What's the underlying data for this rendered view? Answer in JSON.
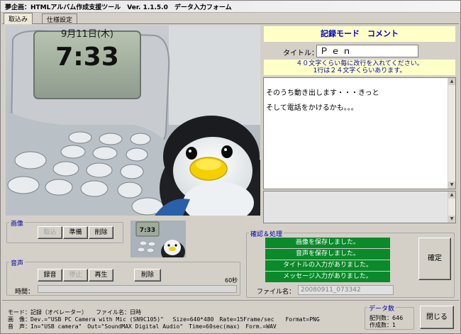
{
  "window": {
    "title": "夢企画：HTMLアルバム作成支援ツール　Ver. 1.1.5.0　データ入力フォーム"
  },
  "tabs": [
    {
      "label": "取込み",
      "active": true
    },
    {
      "label": "仕様設定",
      "active": false
    }
  ],
  "image_group": {
    "label": "画像",
    "buttons": [
      {
        "label": "取込",
        "enabled": false
      },
      {
        "label": "準備",
        "enabled": true
      },
      {
        "label": "削除",
        "enabled": true
      }
    ]
  },
  "audio_group": {
    "label": "音声",
    "buttons": [
      {
        "label": "録音",
        "enabled": true
      },
      {
        "label": "停止",
        "enabled": false
      },
      {
        "label": "再生",
        "enabled": true
      },
      {
        "label": "削除",
        "enabled": true
      }
    ],
    "max_time": "60秒",
    "time_label": "時間："
  },
  "record_mode": {
    "heading": "記録モード　コメント",
    "title_label": "タイトル：",
    "title_value": "Ｐｅｎ",
    "hint_line1": "４０文字くらい毎に改行を入れてください。",
    "hint_line2": "1行は２４文字くらいあります。",
    "memo_lines": [
      "そのうち動き出します・・・きっと",
      "そして電話をかけるかも。。。"
    ]
  },
  "confirm_group": {
    "label": "確認＆処理",
    "statuses": [
      "画像を保存しました。",
      "音声を保存しました。",
      "タイトルの入力がありました。",
      "メッセージ入力がありました。"
    ],
    "confirm_button": "確定",
    "filename_label": "ファイル名：",
    "filename_value": "20080911_073342"
  },
  "info": {
    "mode_line": "モード：記録（オペレーター）　　ファイル名：日時",
    "image_line": "画　像：Dev.=\"USB PC Camera with Mic (SN9C105)\"　 Size=640*480　Rate=15Frame/sec　　Format=PNG",
    "audio_line": "音　声：In=\"USB camera\"　Out=\"SoundMAX Digital Audio\"　Time=60sec(max)　Form.=WAV"
  },
  "data_count": {
    "label": "データ数",
    "layout_label": "配列数：",
    "layout_value": "646",
    "created_label": "作成数：",
    "created_value": "1"
  },
  "close_button": "閉じる",
  "colors": {
    "accent_blue": "#0000c0",
    "status_green": "#0a8a2a",
    "note_yellow": "#ffffc8"
  },
  "photo_clock": {
    "date": "9月11日(木)",
    "time": "7:33"
  }
}
